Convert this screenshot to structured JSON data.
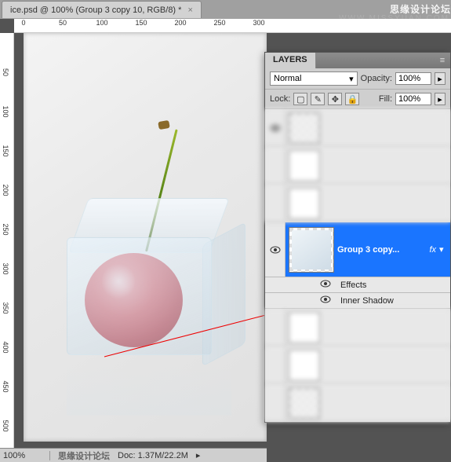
{
  "tab": {
    "title": "ice.psd @ 100% (Group 3 copy 10, RGB/8) *",
    "close": "×"
  },
  "watermark": {
    "site": "思缘设计论坛",
    "url": "WWW.MISSYUAN.COM"
  },
  "ruler_h": [
    "0",
    "50",
    "100",
    "150",
    "200",
    "250",
    "300"
  ],
  "ruler_v": [
    "50",
    "100",
    "150",
    "200",
    "250",
    "300",
    "350",
    "400",
    "450",
    "500"
  ],
  "panel": {
    "title": "LAYERS",
    "blend_label": "Normal",
    "opacity_label": "Opacity:",
    "opacity_value": "100%",
    "lock_label": "Lock:",
    "fill_label": "Fill:",
    "fill_value": "100%",
    "selected_layer": "Group 3 copy...",
    "fx": "fx",
    "effects": "Effects",
    "inner_shadow": "Inner Shadow"
  },
  "status": {
    "zoom": "100%",
    "doc": "Doc: 1.37M/22.2M",
    "mark": "思缘设计论坛"
  },
  "icons": {
    "chevron": "▾",
    "menu": "≡",
    "right": "▸",
    "brush": "✎",
    "move": "✥",
    "lock": "🔒",
    "square": "▢"
  }
}
